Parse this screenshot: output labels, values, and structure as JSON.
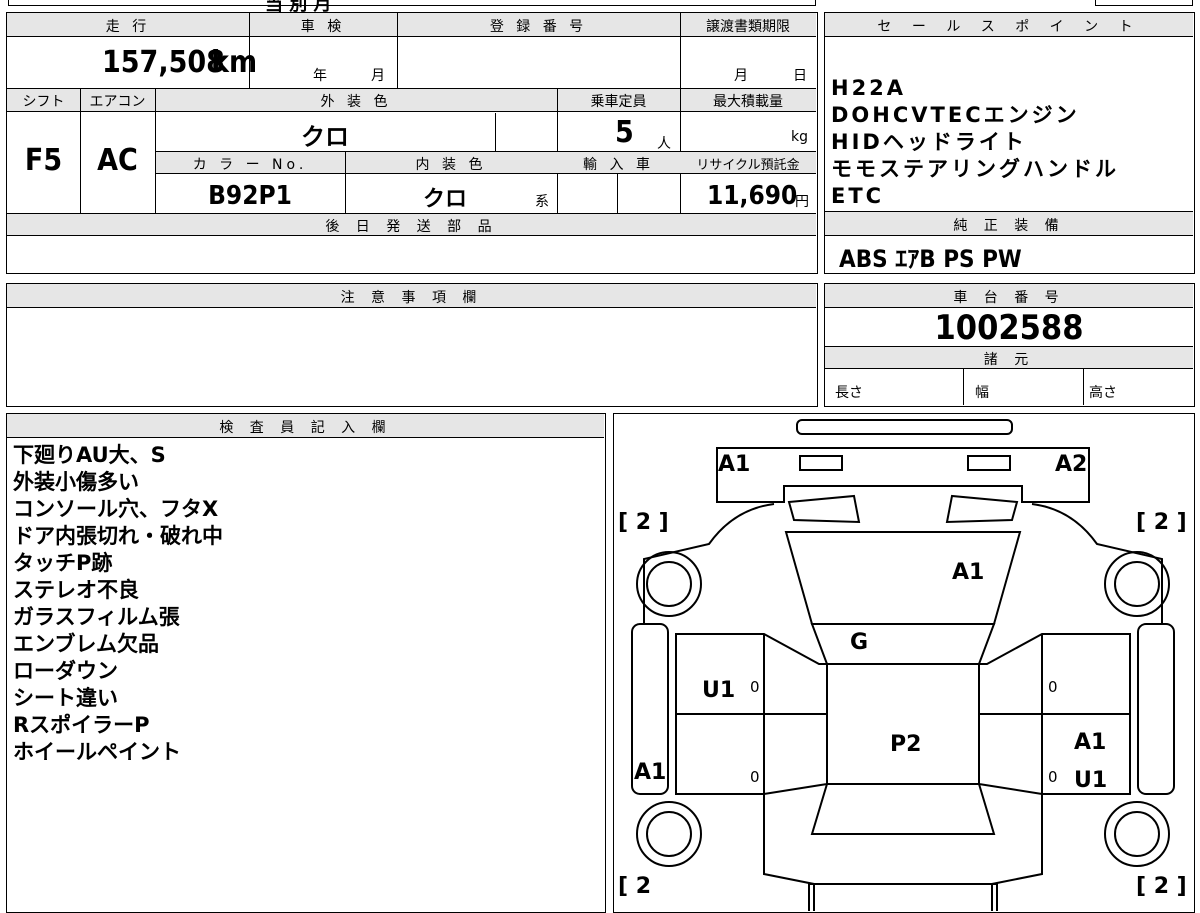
{
  "top_cut": {
    "partial_text": "当 別 月"
  },
  "mileage": {
    "header": "走 行",
    "value": "157,508",
    "unit": "km"
  },
  "shaken": {
    "header": "車 検",
    "year_label": "年",
    "month_label": "月"
  },
  "registration": {
    "header": "登 録 番 号"
  },
  "transfer_deadline": {
    "header": "譲渡書類期限",
    "month_label": "月",
    "day_label": "日"
  },
  "shift": {
    "header": "シフト",
    "value": "F5"
  },
  "aircon": {
    "header": "エアコン",
    "value": "AC"
  },
  "exterior_color": {
    "header": "外 装 色",
    "value": "クロ"
  },
  "capacity": {
    "header": "乗車定員",
    "value": "5",
    "unit": "人"
  },
  "max_load": {
    "header": "最大積載量",
    "unit": "kg"
  },
  "color_no": {
    "header": "カ ラ ー No.",
    "value": "B92P1"
  },
  "interior_color": {
    "header": "内 装 色",
    "value": "クロ",
    "suffix": "系"
  },
  "import": {
    "header": "輸 入 車"
  },
  "recycle": {
    "header": "リサイクル預託金",
    "value": "11,690",
    "unit": "円"
  },
  "later_parts": {
    "header": "後 日 発 送 部 品"
  },
  "sales_points": {
    "header": "セ ー ル ス ポ イ ン ト",
    "lines": [
      "H22A",
      "DOHCVTECエンジン",
      "HIDヘッドライト",
      "モモステアリングハンドル",
      "ETC"
    ]
  },
  "genuine_equipment": {
    "header": "純 正 装 備",
    "value": "ABS ｴｱB PS PW"
  },
  "notes": {
    "header": "注 意 事 項 欄"
  },
  "chassis": {
    "header": "車 台 番 号",
    "value": "1002588"
  },
  "specs": {
    "header": "諸 元",
    "length_label": "長さ",
    "width_label": "幅",
    "height_label": "高さ"
  },
  "inspector": {
    "header": "検 査 員 記 入 欄",
    "lines": [
      "下廻りAU大、S",
      "外装小傷多い",
      "コンソール穴、フタX",
      "ドア内張切れ・破れ中",
      "タッチP跡",
      "ステレオ不良",
      "ガラスフィルム張",
      "エンブレム欠品",
      "ローダウン",
      "シート違い",
      "RスポイラーP",
      "ホイールペイント"
    ]
  },
  "diagram": {
    "marks": {
      "front_left": "A1",
      "front_right": "A2",
      "hood": "A1",
      "windshield": "G",
      "left_front_door": "U1",
      "roof": "P2",
      "left_rear": "A1",
      "right_rear_a": "A1",
      "right_rear_u": "U1",
      "zero_lf": "0",
      "zero_lr": "0",
      "zero_rf": "0",
      "zero_rr": "0"
    },
    "tire_tl": "[ 2 ]",
    "tire_tr": "[ 2 ]",
    "tire_bl": "[ 2 ",
    "tire_br": "[ 2 ]"
  }
}
